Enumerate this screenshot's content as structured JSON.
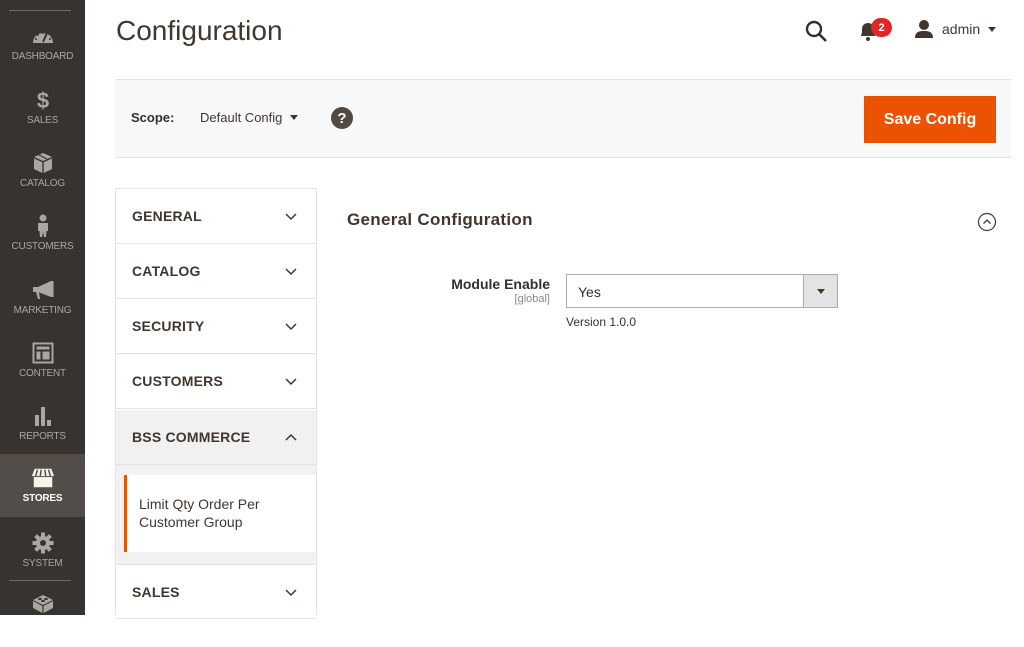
{
  "nav": {
    "items": [
      {
        "label": "DASHBOARD",
        "icon": "dashboard-icon"
      },
      {
        "label": "SALES",
        "icon": "dollar-icon"
      },
      {
        "label": "CATALOG",
        "icon": "box-icon"
      },
      {
        "label": "CUSTOMERS",
        "icon": "person-icon"
      },
      {
        "label": "MARKETING",
        "icon": "megaphone-icon"
      },
      {
        "label": "CONTENT",
        "icon": "layout-icon"
      },
      {
        "label": "REPORTS",
        "icon": "bar-chart-icon"
      },
      {
        "label": "STORES",
        "icon": "storefront-icon",
        "active": true
      },
      {
        "label": "SYSTEM",
        "icon": "gear-icon"
      }
    ],
    "extensions_icon": "lego-brick-icon"
  },
  "header": {
    "title": "Configuration",
    "notifications_count": "2",
    "user": "admin"
  },
  "toolbar": {
    "scope_label": "Scope:",
    "scope_value": "Default Config",
    "help": "?",
    "save_label": "Save Config"
  },
  "tabs": [
    {
      "label": "GENERAL",
      "expanded": false
    },
    {
      "label": "CATALOG",
      "expanded": false
    },
    {
      "label": "SECURITY",
      "expanded": false
    },
    {
      "label": "CUSTOMERS",
      "expanded": false
    },
    {
      "label": "BSS COMMERCE",
      "expanded": true,
      "items": [
        "Limit Qty Order Per Customer Group"
      ]
    },
    {
      "label": "SALES",
      "expanded": false
    }
  ],
  "section": {
    "title": "General Configuration",
    "fields": [
      {
        "label": "Module Enable",
        "scope": "[global]",
        "value": "Yes",
        "note": "Version 1.0.0"
      }
    ]
  },
  "colors": {
    "accent": "#eb5202",
    "nav_bg": "#373330",
    "nav_active": "#524d49",
    "badge": "#e22626"
  }
}
